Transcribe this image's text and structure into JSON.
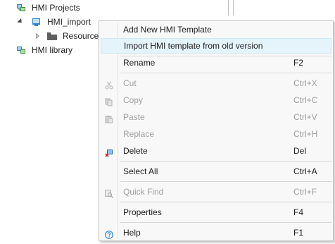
{
  "tree": {
    "items": [
      {
        "label": "HMI Projects"
      },
      {
        "label": "HMI_import"
      },
      {
        "label": "Resources"
      },
      {
        "label": "HMI library"
      }
    ]
  },
  "menu": {
    "items": [
      {
        "label": "Add New HMI Template",
        "shortcut": ""
      },
      {
        "label": "Import HMI template from old version",
        "shortcut": ""
      },
      {
        "label": "Rename",
        "shortcut": "F2"
      },
      {
        "label": "Cut",
        "shortcut": "Ctrl+X"
      },
      {
        "label": "Copy",
        "shortcut": "Ctrl+C"
      },
      {
        "label": "Paste",
        "shortcut": "Ctrl+V"
      },
      {
        "label": "Replace",
        "shortcut": "Ctrl+H"
      },
      {
        "label": "Delete",
        "shortcut": "Del"
      },
      {
        "label": "Select All",
        "shortcut": "Ctrl+A"
      },
      {
        "label": "Quick Find",
        "shortcut": "Ctrl+F"
      },
      {
        "label": "Properties",
        "shortcut": "F4"
      },
      {
        "label": "Help",
        "shortcut": "F1"
      }
    ]
  }
}
